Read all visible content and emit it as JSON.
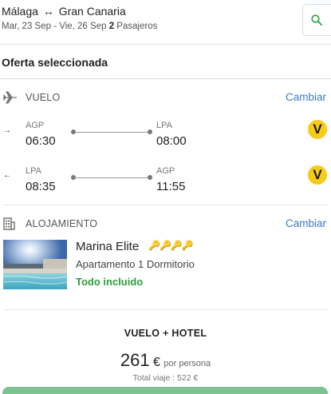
{
  "header": {
    "origin": "Málaga",
    "route_arrow": "↔",
    "destination": "Gran Canaria",
    "dates": "Mar, 23 Sep - Vie, 26 Sep",
    "passenger_count": "2",
    "passengers_label": "Pasajeros",
    "search_icon": "search-icon"
  },
  "offer": {
    "title": "Oferta seleccionada"
  },
  "flight": {
    "label": "VUELO",
    "change_label": "Cambiar",
    "icon": "plane-icon",
    "legs": [
      {
        "direction_arrow": "→",
        "from_code": "AGP",
        "depart_time": "06:30",
        "to_code": "LPA",
        "arrive_time": "08:00",
        "airline_logo_text": "V"
      },
      {
        "direction_arrow": "←",
        "from_code": "LPA",
        "depart_time": "08:35",
        "to_code": "AGP",
        "arrive_time": "11:55",
        "airline_logo_text": "V"
      }
    ]
  },
  "accommodation": {
    "label": "ALOJAMIENTO",
    "change_label": "Cambiar",
    "icon": "building-icon",
    "hotel_name": "Marina Elite",
    "rating_keys": 4,
    "room_type": "Apartamento 1 Dormitorio",
    "board_type": "Todo incluido",
    "board_color": "#2e9e3b"
  },
  "price": {
    "package_title": "VUELO + HOTEL",
    "amount": "261",
    "currency": "€",
    "per_label": "por persona",
    "total_label": "Total viaje : 522 €"
  },
  "colors": {
    "link": "#3a7bbf",
    "airline_yellow": "#f6cc19",
    "cta_green": "#7dc291"
  }
}
